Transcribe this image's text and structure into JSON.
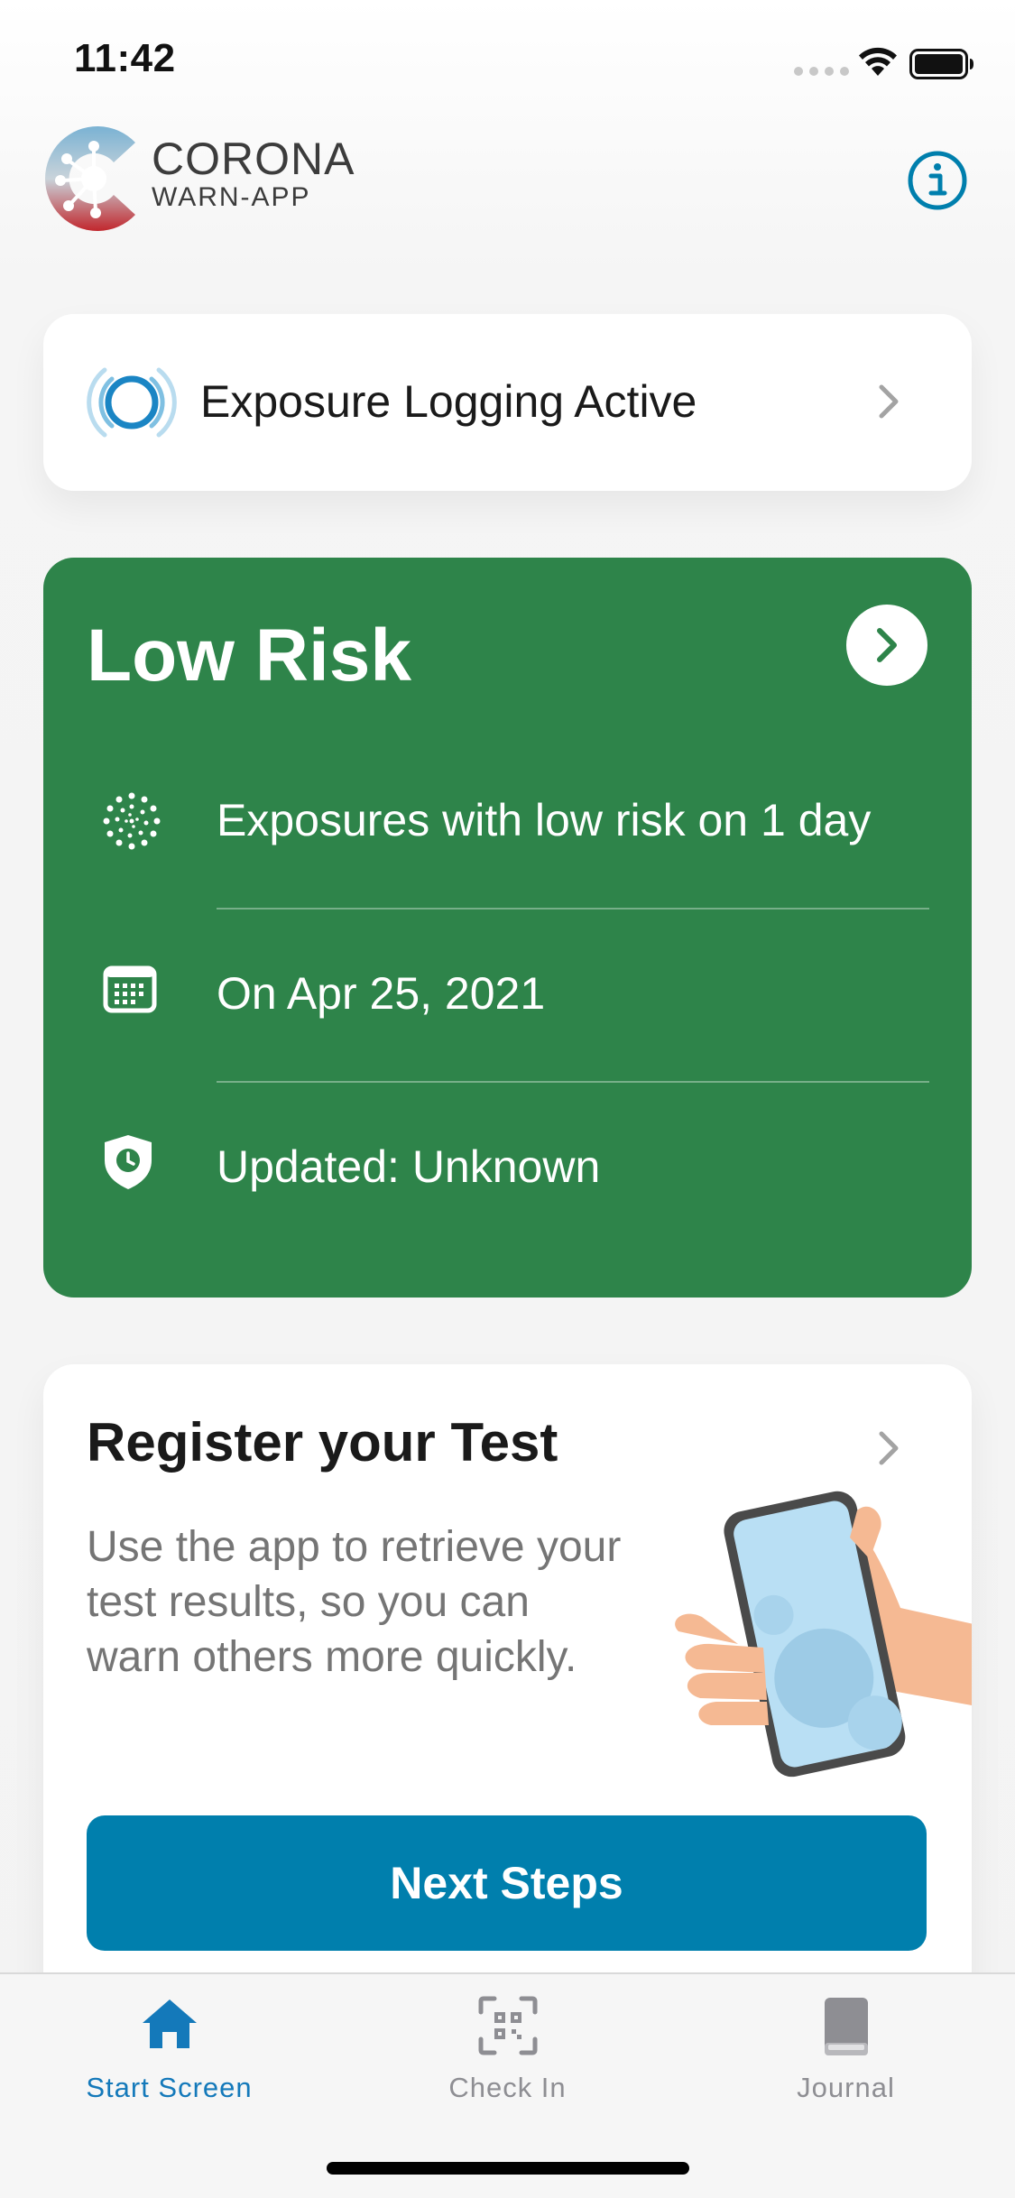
{
  "status_bar": {
    "time": "11:42"
  },
  "header": {
    "app_name_line1": "CORONA",
    "app_name_line2": "WARN-APP",
    "info_icon": "info-icon"
  },
  "exposure": {
    "label": "Exposure Logging Active",
    "icon": "exposure-logging-icon"
  },
  "risk": {
    "title": "Low Risk",
    "color": "#2e844a",
    "rows": [
      {
        "icon": "virus-icon",
        "text": "Exposures with low risk on 1 day"
      },
      {
        "icon": "calendar-icon",
        "text": "On Apr 25, 2021"
      },
      {
        "icon": "shield-clock-icon",
        "text": "Updated: Unknown"
      }
    ]
  },
  "test": {
    "title": "Register your Test",
    "description": "Use the app to retrieve your test results, so you can warn others more quickly.",
    "button_label": "Next Steps",
    "button_color": "#007fad"
  },
  "tabs": [
    {
      "label": "Start Screen",
      "icon": "home-icon",
      "active": true
    },
    {
      "label": "Check In",
      "icon": "qr-code-icon",
      "active": false
    },
    {
      "label": "Journal",
      "icon": "book-icon",
      "active": false
    }
  ],
  "colors": {
    "accent": "#007fad",
    "active_tab": "#1479ba",
    "inactive_tab": "#8e8e93"
  }
}
